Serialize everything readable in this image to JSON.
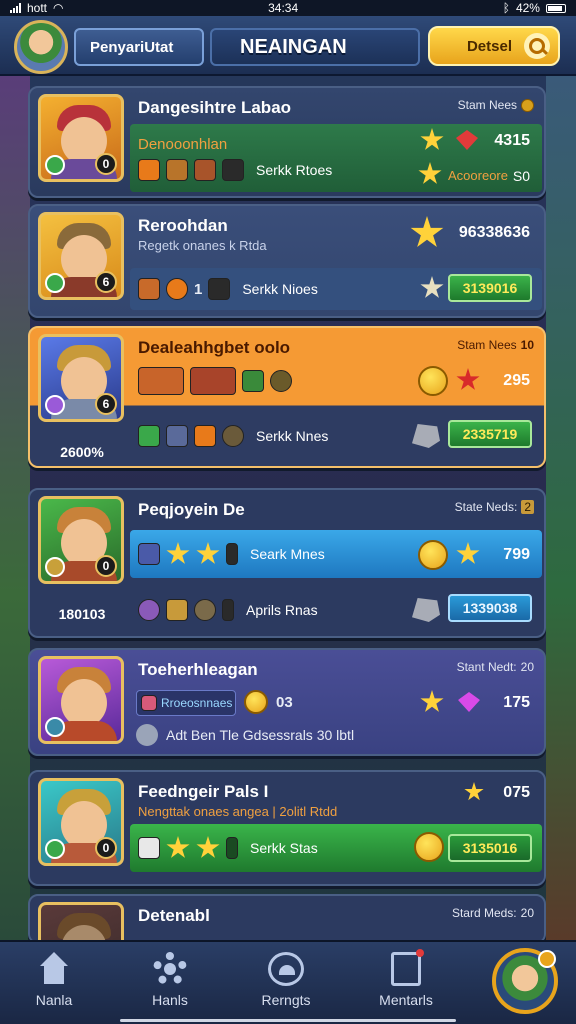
{
  "status_bar": {
    "carrier": "hott",
    "time": "34:34",
    "battery": "42%"
  },
  "header": {
    "player_name": "PenyariUtat",
    "title": "NEAINGAN",
    "search_label": "Detsel"
  },
  "cards": [
    {
      "name": "Dangesihtre Labao",
      "subtitle": "Denooonhlan",
      "stat_label": "Stam Nees",
      "level": "0",
      "strip_text": "Serkk Rtoes",
      "top_value": "4315",
      "bottom_label": "Acooreore",
      "bottom_value": "S0"
    },
    {
      "name": "Reroohdan",
      "subtitle": "Regetk onanes k Rtda",
      "level": "6",
      "top_value": "96338636",
      "strip_count": "1",
      "strip_text": "Serkk Nioes",
      "pill_value": "3139016"
    },
    {
      "name": "Dealeahhgbet oolo",
      "stat_label": "Stam Nees",
      "stat_value": "10",
      "level": "6",
      "top_value": "295",
      "strip_text": "Serkk Nnes",
      "pill_value": "2335719",
      "under_portrait": "2600%"
    },
    {
      "name": "Peqjoyein De",
      "stat_label": "State Neds:",
      "stat_value": "2",
      "level": "0",
      "strip_text": "Seark Mnes",
      "top_value": "799",
      "bottom_text": "Aprils Rnas",
      "pill_value": "1339038",
      "under_portrait": "180103"
    },
    {
      "name": "Toeherhleagan",
      "stat_label": "Stant Nedt:",
      "stat_value": "20",
      "chip_label": "Rroeosnnaes",
      "chip_value": "03",
      "top_value": "175",
      "bottom_text": "Adt Ben Tle Gdsessrals 30 lbtl"
    },
    {
      "name": "Feedngeir Pals I",
      "subtitle": "Nengttak onaes angea | 2olitl Rtdd",
      "level": "0",
      "top_value": "075",
      "strip_text": "Serkk Stas",
      "pill_value": "3135016"
    },
    {
      "name": "Detenabl",
      "stat_label": "Stard Meds:",
      "stat_value": "20"
    }
  ],
  "nav": [
    {
      "label": "Nanla",
      "icon": "home-icon"
    },
    {
      "label": "Hanls",
      "icon": "gear-icon"
    },
    {
      "label": "Rerngts",
      "icon": "medal-icon"
    },
    {
      "label": "Mentarls",
      "icon": "document-icon"
    }
  ],
  "colors": {
    "accent_gold": "#e8a41c",
    "strip_green": "#2e7a3a",
    "strip_orange": "#f08a2c",
    "strip_blue": "#2a9ad8",
    "card_bg": "#33466e"
  }
}
